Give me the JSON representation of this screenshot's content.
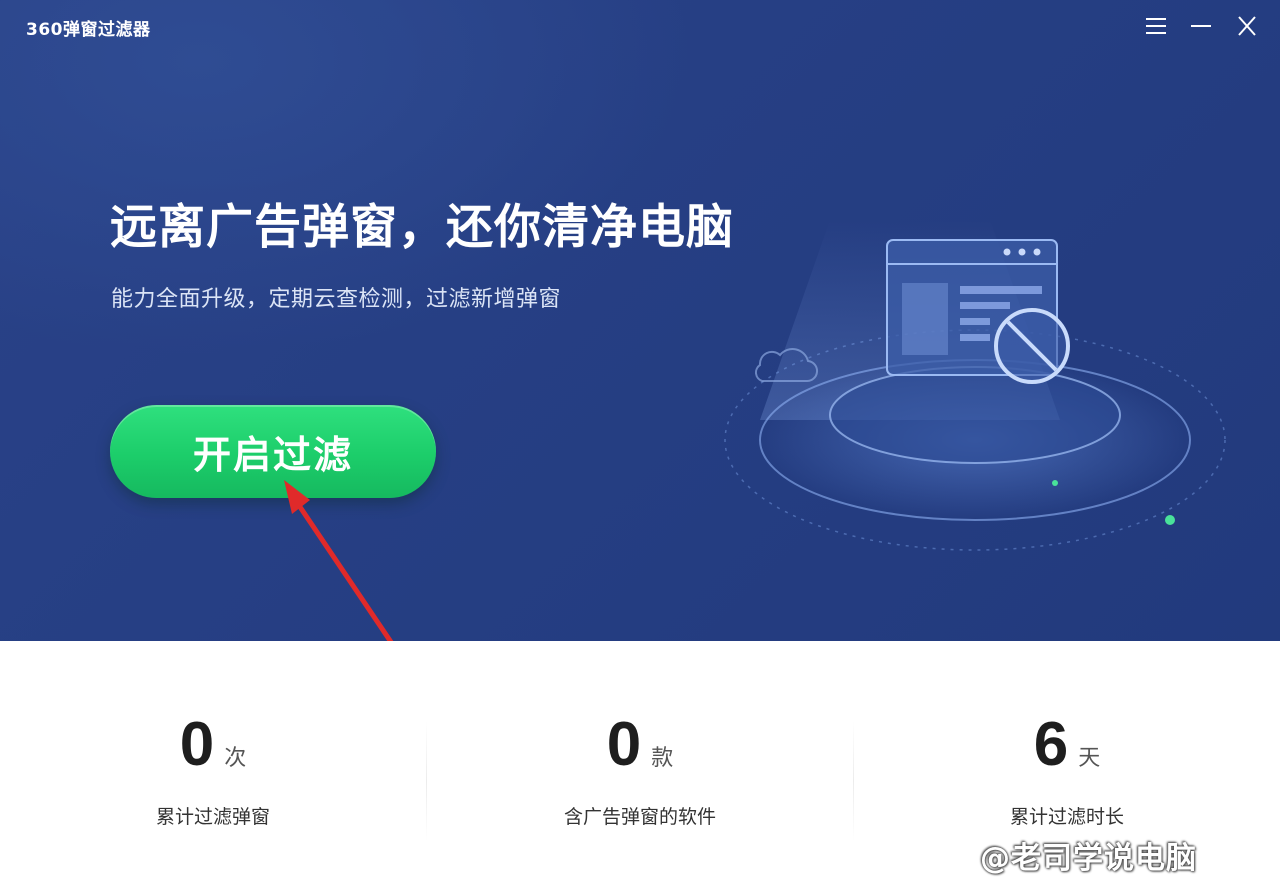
{
  "window": {
    "title": "360弹窗过滤器",
    "controls": {
      "menu_icon": "menu-icon",
      "minimize_icon": "minimize-icon",
      "close_icon": "close-icon"
    }
  },
  "hero": {
    "headline": "远离广告弹窗，还你清净电脑",
    "subline": "能力全面升级，定期云查检测，过滤新增弹窗",
    "start_button_label": "开启过滤",
    "background_color": "#263f84",
    "button_color": "#1ccd6a"
  },
  "stats": [
    {
      "value": "0",
      "unit": "次",
      "label": "累计过滤弹窗"
    },
    {
      "value": "0",
      "unit": "款",
      "label": "含广告弹窗的软件"
    },
    {
      "value": "6",
      "unit": "天",
      "label": "累计过滤时长"
    }
  ],
  "watermark": {
    "text": "@老司学说电脑"
  },
  "annotation": {
    "arrow_color": "#e02a2a"
  }
}
